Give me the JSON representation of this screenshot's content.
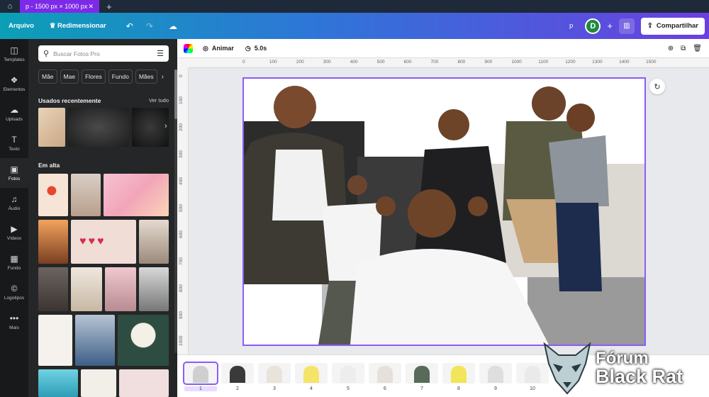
{
  "tab": {
    "title": "p - 1500 px × 1000 px"
  },
  "toolbar": {
    "file_label": "Arquivo",
    "resize_label": "Redimensionar",
    "project_name": "p",
    "avatar_initial": "D",
    "share_label": "Compartilhar"
  },
  "rail": {
    "items": [
      {
        "label": "Templates",
        "icon": "templates-icon"
      },
      {
        "label": "Elementos",
        "icon": "elements-icon"
      },
      {
        "label": "Uploads",
        "icon": "upload-icon"
      },
      {
        "label": "Texto",
        "icon": "text-icon"
      },
      {
        "label": "Fotos",
        "icon": "photos-icon"
      },
      {
        "label": "Áudio",
        "icon": "audio-icon"
      },
      {
        "label": "Vídeos",
        "icon": "video-icon"
      },
      {
        "label": "Fundo",
        "icon": "background-icon"
      },
      {
        "label": "Logotipos",
        "icon": "logos-icon"
      },
      {
        "label": "Mais",
        "icon": "more-icon"
      }
    ],
    "active_index": 4
  },
  "panel": {
    "search_placeholder": "Buscar Fotos Pro",
    "chips": [
      "Mãe",
      "Mae",
      "Flores",
      "Fundo",
      "Mães"
    ],
    "recent_title": "Usados recentemente",
    "see_all": "Ver tudo",
    "trending_title": "Em alta"
  },
  "context": {
    "animate_label": "Animar",
    "duration": "5.0s"
  },
  "ruler": {
    "h_ticks": [
      "0",
      "50",
      "100",
      "150",
      "200",
      "250",
      "300",
      "350",
      "400",
      "450",
      "500",
      "550",
      "600",
      "650",
      "700",
      "750",
      "800",
      "850",
      "900",
      "950",
      "1000",
      "1050",
      "1100",
      "1150",
      "1200",
      "1250",
      "1300",
      "1350",
      "1400",
      "1450",
      "1500"
    ],
    "v_ticks": [
      "0",
      "100",
      "200",
      "300",
      "400",
      "500",
      "600",
      "700",
      "800",
      "900",
      "1000"
    ]
  },
  "pages": [
    "1",
    "2",
    "3",
    "4",
    "5",
    "6",
    "7",
    "8",
    "9",
    "10"
  ],
  "selected_page": 0,
  "watermark": {
    "line1": "Fórum",
    "line2": "Black Rat"
  },
  "colors": {
    "accent": "#8b5cf6",
    "share_bg": "#ffffff",
    "avatar": "#1f8a3c"
  }
}
